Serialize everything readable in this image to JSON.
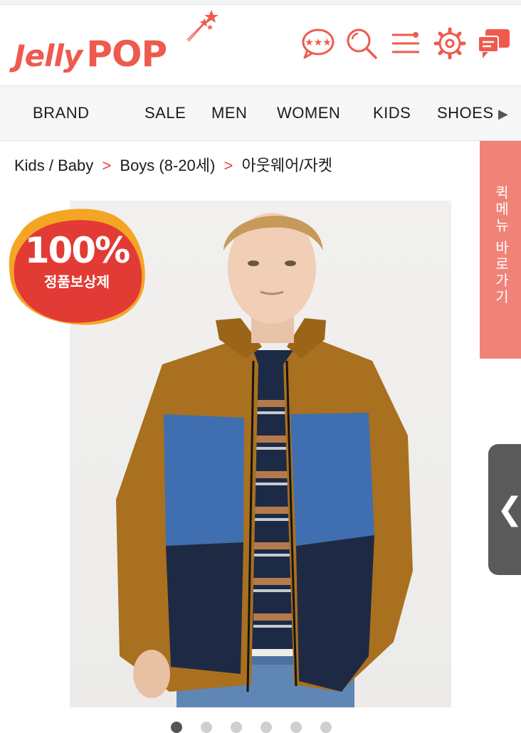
{
  "brand": {
    "name_part1": "Jelly",
    "name_part2": "POP"
  },
  "header_icons": [
    "chat-icon",
    "search-icon",
    "menu-icon",
    "settings-icon",
    "message-icon"
  ],
  "nav": {
    "items": [
      "BRAND",
      "SALE",
      "MEN",
      "WOMEN",
      "KIDS",
      "SHOES"
    ],
    "more_symbol": "▶"
  },
  "breadcrumb": {
    "items": [
      "Kids / Baby",
      "Boys (8-20세)",
      "아웃웨어/자켓"
    ],
    "separator": ">"
  },
  "badge": {
    "number": "100%",
    "text": "정품보상제"
  },
  "quick_menu": {
    "label": "퀵메뉴 바로가기"
  },
  "side_handle": {
    "symbol": "❮"
  },
  "carousel": {
    "count": 6,
    "active_index": 0
  },
  "colors": {
    "brand": "#ee5a4d",
    "accent": "#e8463c",
    "quick_tab": "#f08378"
  }
}
